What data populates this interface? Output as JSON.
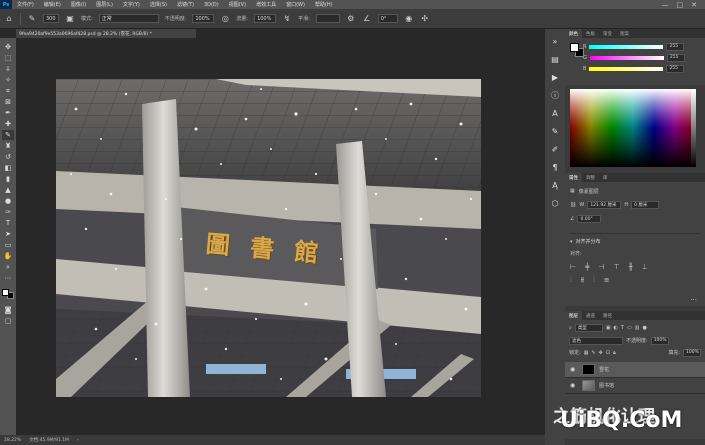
{
  "menubar": {
    "logo": "Ps",
    "items": [
      "文件(F)",
      "编辑(E)",
      "图像(I)",
      "图层(L)",
      "文字(Y)",
      "选择(S)",
      "滤镜(T)",
      "3D(D)",
      "视图(V)",
      "增效工具",
      "窗口(W)",
      "帮助(H)"
    ],
    "window_buttons": [
      "—",
      "□",
      "✕"
    ]
  },
  "options": {
    "brush_size": "300",
    "mode_label": "模式:",
    "mode_value": "正常",
    "opacity_label": "不透明度:",
    "opacity_value": "100%",
    "flow_label": "流量:",
    "flow_value": "100%",
    "smoothing_label": "平滑:",
    "angle_value": "0°"
  },
  "document": {
    "tab_title": "9fea9420af9e553a0696af428.psd @ 28.2% (雪花, RGB/8) *",
    "sign_text": "圖 書 館"
  },
  "status": {
    "zoom": "28.22%",
    "doc_size": "文档:45.9M/91.1M"
  },
  "color_panel": {
    "tabs": [
      "颜色",
      "色板",
      "渐变",
      "图案"
    ],
    "channels": [
      {
        "label": "R",
        "value": "255"
      },
      {
        "label": "G",
        "value": "255"
      },
      {
        "label": "B",
        "value": "255"
      }
    ]
  },
  "properties_panel": {
    "tabs": [
      "属性",
      "调整",
      "库"
    ],
    "kind": "像素图层",
    "w_label": "W",
    "w_value": "121.92 厘米",
    "h_label": "H",
    "h_value": "0 厘米",
    "angle_value": "0.00°",
    "align_header": "对齐并分布",
    "align_label": "对齐:",
    "more": "..."
  },
  "layers_panel": {
    "tabs": [
      "图层",
      "通道",
      "路径"
    ],
    "filter_label": "类型",
    "blend_mode": "滤色",
    "opacity_label": "不透明度:",
    "opacity_value": "100%",
    "lock_label": "锁定:",
    "fill_label": "填充:",
    "fill_value": "100%",
    "layers": [
      {
        "name": "雪花",
        "thumb": "#000000"
      },
      {
        "name": "图书馆",
        "thumb": "#8a8a8a"
      }
    ]
  },
  "watermark": {
    "text": "UiBQ.CoM",
    "overlay_text": "之筋机化让理"
  },
  "colors": {
    "accent": "#31a8ff",
    "panel": "#3a3a3a",
    "menubar": "#535353",
    "sign_gold": "#d8a84a"
  }
}
